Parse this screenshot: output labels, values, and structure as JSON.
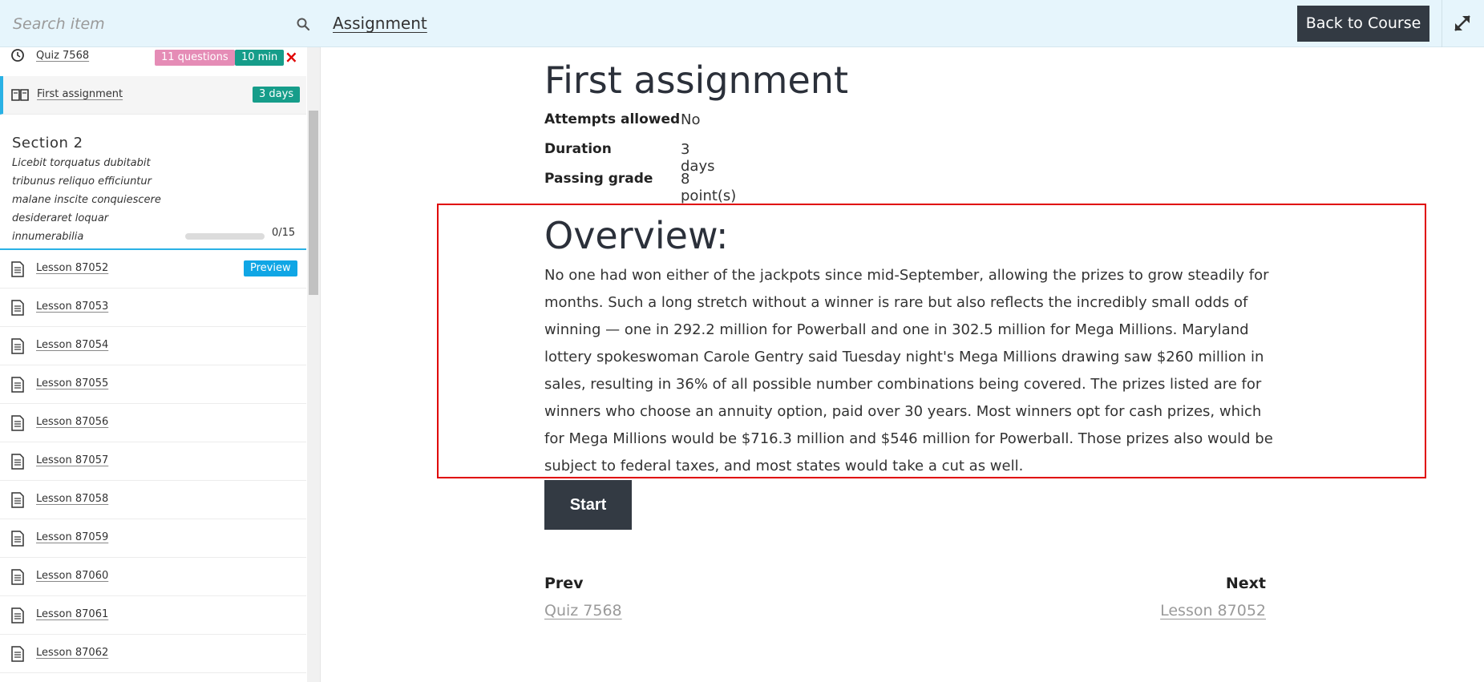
{
  "header": {
    "search_placeholder": "Search item",
    "assignment_link": "Assignment",
    "back_button": "Back to Course"
  },
  "sidebar": {
    "quiz": {
      "label": "Quiz 7568",
      "questions_badge": "11 questions",
      "duration_badge": "10 min",
      "remove": "×"
    },
    "assignment": {
      "label": "First assignment",
      "duration_badge": "3 days"
    },
    "section": {
      "title": "Section 2",
      "description": "Licebit torquatus dubitabit tribunus reliquo efficiuntur malane inscite conquiescere desideraret loquar innumerabilia",
      "progress_text": "0/15",
      "progress_fraction": 0
    },
    "lessons": [
      {
        "label": "Lesson 87052",
        "badge": "Preview"
      },
      {
        "label": "Lesson 87053"
      },
      {
        "label": "Lesson 87054"
      },
      {
        "label": "Lesson 87055"
      },
      {
        "label": "Lesson 87056"
      },
      {
        "label": "Lesson 87057"
      },
      {
        "label": "Lesson 87058"
      },
      {
        "label": "Lesson 87059"
      },
      {
        "label": "Lesson 87060"
      },
      {
        "label": "Lesson 87061"
      },
      {
        "label": "Lesson 87062"
      }
    ]
  },
  "main": {
    "title": "First assignment",
    "meta": [
      {
        "key": "Attempts allowed",
        "value": "No"
      },
      {
        "key": "Duration",
        "value": "3 days"
      },
      {
        "key": "Passing grade",
        "value": "8 point(s)"
      }
    ],
    "overview_title": "Overview:",
    "overview_text": "No one had won either of the jackpots since mid-September, allowing the prizes to grow steadily for months. Such a long stretch without a winner is rare but also reflects the incredibly small odds of winning — one in 292.2 million for Powerball and one in 302.5 million for Mega Millions. Maryland lottery spokeswoman Carole Gentry said Tuesday night's Mega Millions drawing saw $260 million in sales, resulting in 36% of all possible number combinations being covered. The prizes listed are for winners who choose an annuity option, paid over 30 years. Most winners opt for cash prizes, which for Mega Millions would be $716.3 million and $546 million for Powerball. Those prizes also would be subject to federal taxes, and most states would take a cut as well.",
    "start_button": "Start",
    "prev_label": "Prev",
    "prev_link": "Quiz 7568",
    "next_label": "Next",
    "next_link": "Lesson 87052"
  },
  "colors": {
    "topbar_bg": "#e6f5fc",
    "dark_button": "#333a43",
    "accent": "#29b1e5",
    "questions_badge": "#e58cb6",
    "duration_badge": "#169d8a",
    "preview_badge": "#10a6e5",
    "highlight_border": "#e00000"
  }
}
